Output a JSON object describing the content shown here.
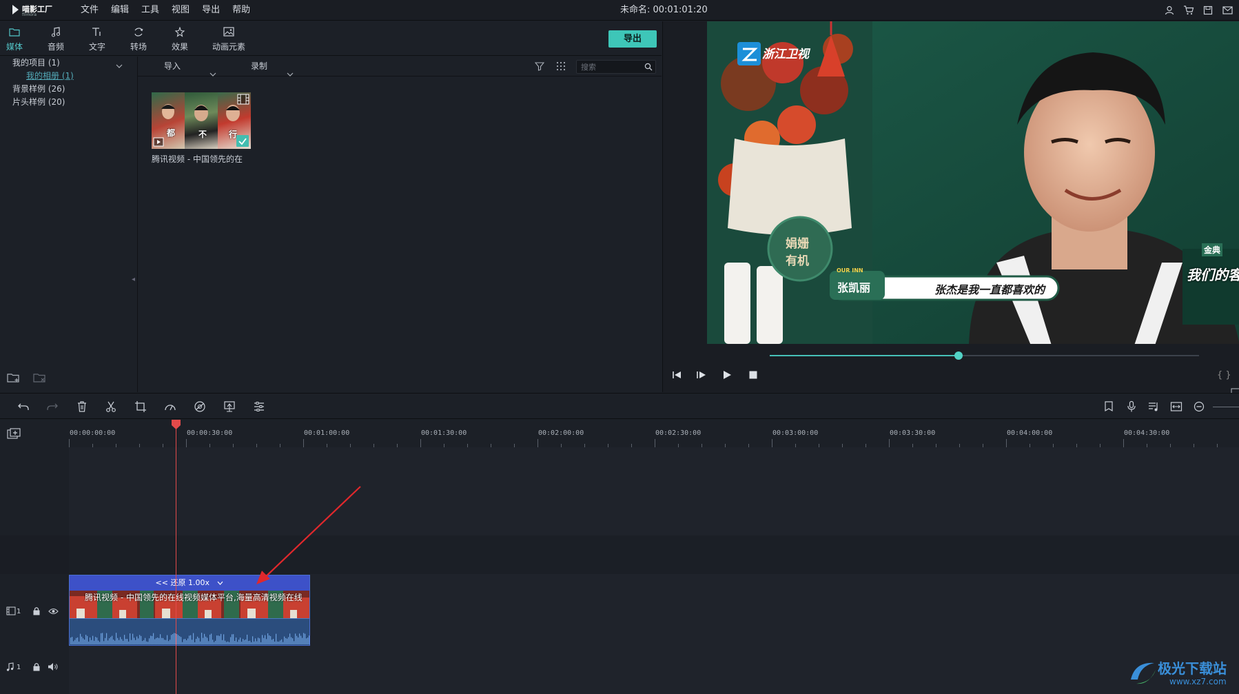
{
  "app": {
    "logo_text": "喵影工厂",
    "logo_sub": "filmora",
    "menu": [
      "文件",
      "编辑",
      "工具",
      "视图",
      "导出",
      "帮助"
    ],
    "project_title": "未命名: 00:01:01:20"
  },
  "tabs": [
    {
      "label": "媒体",
      "icon": "folder-icon",
      "active": true
    },
    {
      "label": "音频",
      "icon": "music-note-icon",
      "active": false
    },
    {
      "label": "文字",
      "icon": "text-icon",
      "active": false
    },
    {
      "label": "转场",
      "icon": "transition-icon",
      "active": false
    },
    {
      "label": "效果",
      "icon": "effects-icon",
      "active": false
    },
    {
      "label": "动画元素",
      "icon": "image-icon",
      "active": false
    }
  ],
  "export_label": "导出",
  "library": {
    "my_project": "我的项目 (1)",
    "my_album": "我的相册 (1)",
    "bg_samples": "背景样例 (26)",
    "intro_samples": "片头样例 (20)"
  },
  "media_toolbar": {
    "import_label": "导入",
    "record_label": "录制",
    "search_placeholder": "搜索"
  },
  "media_items": [
    {
      "label": "腾讯视频 - 中国领先的在",
      "overlay_chars": [
        "都",
        "不",
        "行"
      ]
    }
  ],
  "preview": {
    "channel": "浙江卫视",
    "lower_third_name": "张凯丽",
    "lower_third_tag": "OUR INN",
    "subtitle": "张杰是我一直都喜欢的",
    "sign_text": [
      "娟姗",
      "有机"
    ],
    "show_logo": "我们的客栈",
    "show_badge": "金典",
    "playback_progress": 0.44
  },
  "ruler": {
    "labels": [
      "00:00:00:00",
      "00:00:30:00",
      "00:01:00:00",
      "00:01:30:00",
      "00:02:00:00",
      "00:02:30:00",
      "00:03:00:00",
      "00:03:30:00",
      "00:04:00:00",
      "00:04:30:00"
    ]
  },
  "tracks": {
    "video_track_num": "1",
    "audio_track_num": "1"
  },
  "clip": {
    "speed_label": "<< 还原 1.00x",
    "title": "腾讯视频 - 中国领先的在线视频媒体平台,海量高清视频在线"
  },
  "watermark": {
    "text": "极光下载站",
    "url": "www.xz7.com"
  },
  "colors": {
    "accent": "#3ec6b8",
    "clip_header": "#3d51c8",
    "playhead": "#e24a4a",
    "annotation_arrow": "#e0282c"
  }
}
